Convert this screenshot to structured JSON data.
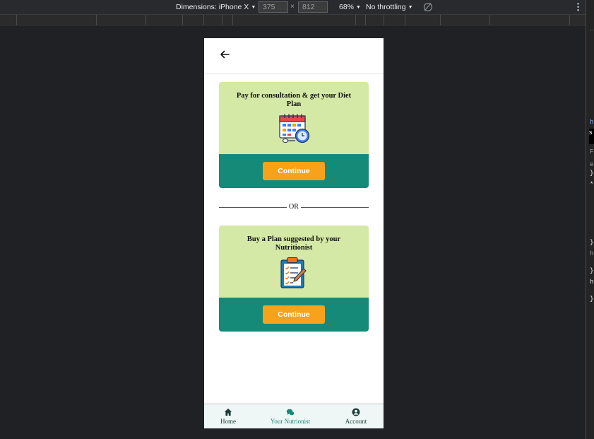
{
  "devtools": {
    "dimensions_label": "Dimensions: iPhone X",
    "width_value": "375",
    "height_value": "812",
    "times_symbol": "×",
    "zoom": "68%",
    "throttling": "No throttling"
  },
  "side_panel": {
    "glyphs": [
      "h",
      "F",
      "e",
      "}",
      "*",
      "}",
      "h",
      "}",
      "h",
      "}"
    ],
    "dark_label": "s"
  },
  "app": {
    "back_icon": "arrow-left-icon",
    "cards": [
      {
        "title": "Pay for consultation & get your Diet Plan",
        "illustration": "calendar-clock-icon",
        "button_label": "Continue"
      },
      {
        "title": "Buy a Plan suggested by your Nutritionist",
        "illustration": "clipboard-checklist-icon",
        "button_label": "Continue"
      }
    ],
    "divider_label": "OR",
    "bottom_nav": [
      {
        "label": "Home",
        "icon": "home-icon",
        "color": "#1a3d35",
        "active": false
      },
      {
        "label": "Your Nutrionist",
        "icon": "chat-bubbles-icon",
        "color": "#168a79",
        "active": true
      },
      {
        "label": "Account",
        "icon": "account-icon",
        "color": "#1a3d35",
        "active": false
      }
    ]
  },
  "colors": {
    "card_bg": "#d4e9a5",
    "card_footer": "#168a79",
    "button": "#f7a21b"
  }
}
